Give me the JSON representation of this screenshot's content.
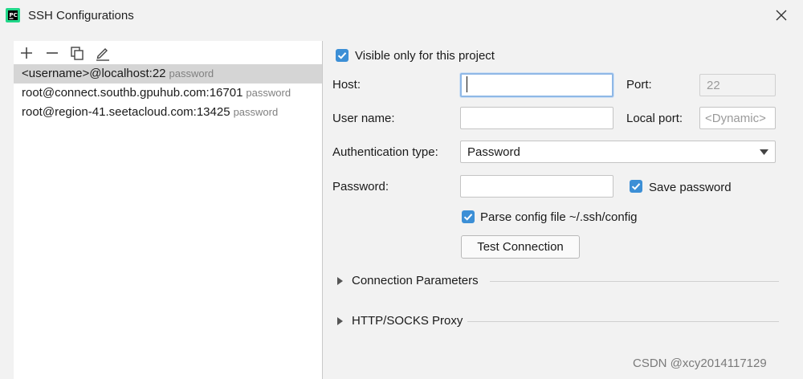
{
  "window": {
    "title": "SSH Configurations",
    "icon": "pycharm-app-icon",
    "close_icon": "close-icon"
  },
  "toolbar": {
    "add_icon": "plus-icon",
    "remove_icon": "minus-icon",
    "copy_icon": "copy-icon",
    "edit_icon": "pencil-icon"
  },
  "configs": [
    {
      "name": "<username>@localhost:22",
      "auth": "password",
      "selected": true
    },
    {
      "name": "root@connect.southb.gpuhub.com:16701",
      "auth": "password",
      "selected": false
    },
    {
      "name": "root@region-41.seetacloud.com:13425",
      "auth": "password",
      "selected": false
    }
  ],
  "form": {
    "visible_only_label": "Visible only for this project",
    "visible_only_checked": true,
    "host_label": "Host:",
    "host_value": "",
    "port_label": "Port:",
    "port_value": "22",
    "username_label": "User name:",
    "username_value": "",
    "local_port_label": "Local port:",
    "local_port_placeholder": "<Dynamic>",
    "auth_type_label": "Authentication type:",
    "auth_type_value": "Password",
    "password_label": "Password:",
    "password_value": "",
    "save_password_label": "Save password",
    "save_password_checked": true,
    "parse_config_label": "Parse config file ~/.ssh/config",
    "parse_config_checked": true,
    "test_connection_label": "Test Connection"
  },
  "sections": [
    {
      "label": "Connection Parameters",
      "expanded": false
    },
    {
      "label": "HTTP/SOCKS Proxy",
      "expanded": false
    }
  ],
  "watermark": "CSDN @xcy2014117129",
  "colors": {
    "accent": "#3c8fd6",
    "selected_row": "#d5d5d5",
    "focus_border": "#8fb8e6"
  }
}
